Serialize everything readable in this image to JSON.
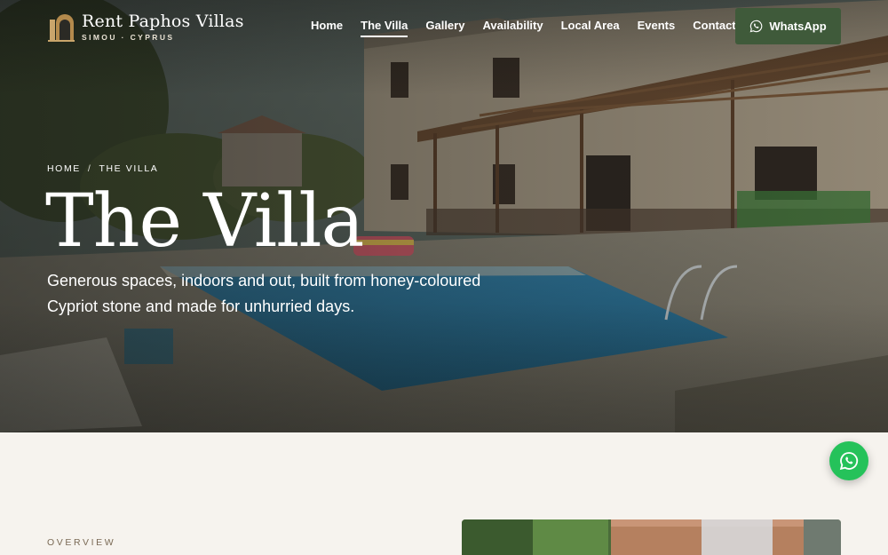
{
  "brand": {
    "title": "Rent Paphos Villas",
    "subtitle": "SIMOU · CYPRUS"
  },
  "nav": {
    "items": [
      {
        "label": "Home",
        "active": false
      },
      {
        "label": "The Villa",
        "active": true
      },
      {
        "label": "Gallery",
        "active": false
      },
      {
        "label": "Availability",
        "active": false
      },
      {
        "label": "Local Area",
        "active": false
      },
      {
        "label": "Events",
        "active": false
      },
      {
        "label": "Contact",
        "active": false
      }
    ],
    "cta_label": "WhatsApp"
  },
  "hero": {
    "breadcrumb": [
      "HOME",
      "THE VILLA"
    ],
    "breadcrumb_separator": "/",
    "title": "The Villa",
    "subtitle": "Generous spaces, indoors and out, built from honey-coloured Cypriot stone and made for unhurried days."
  },
  "overview": {
    "eyebrow": "OVERVIEW"
  },
  "floating": {
    "icon": "whatsapp-icon"
  },
  "colors": {
    "page_bg": "#f6f3ee",
    "cta_green": "#3f5a3a",
    "float_green": "#25c25a",
    "eyebrow": "#7a6a55"
  }
}
